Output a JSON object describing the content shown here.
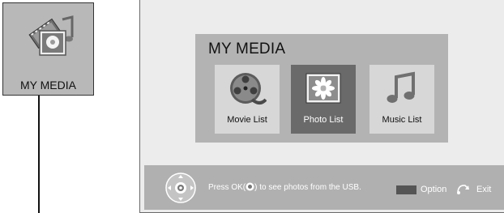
{
  "callout": {
    "label": "MY MEDIA",
    "icon": "my-media-icon"
  },
  "menu": {
    "title": "MY MEDIA",
    "items": [
      {
        "label": "Movie List",
        "icon": "film-reel-icon",
        "selected": false
      },
      {
        "label": "Photo List",
        "icon": "photo-icon",
        "selected": true
      },
      {
        "label": "Music List",
        "icon": "music-note-icon",
        "selected": false
      }
    ]
  },
  "bottom_bar": {
    "hint_prefix": "Press OK(",
    "hint_suffix": ") to see photos from the USB.",
    "option_label": "Option",
    "exit_label": "Exit"
  },
  "colors": {
    "selected_item": "#6a6a6a",
    "panel": "#b3b3b3",
    "option_key": "#555555"
  }
}
